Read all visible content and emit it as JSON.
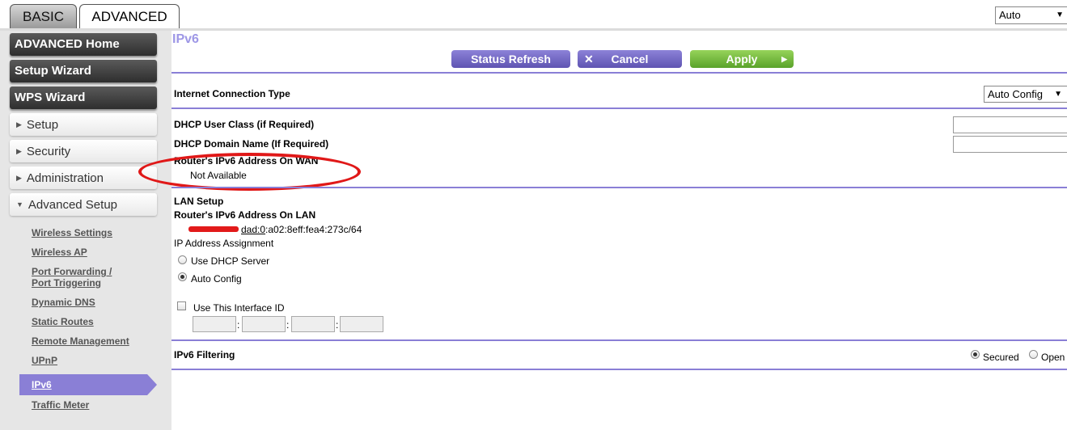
{
  "tabs": {
    "basic": "BASIC",
    "advanced": "ADVANCED"
  },
  "language_select": {
    "value": "Auto"
  },
  "sidebar": {
    "main_items": [
      "ADVANCED Home",
      "Setup Wizard",
      "WPS Wizard"
    ],
    "sections": [
      "Setup",
      "Security",
      "Administration",
      "Advanced Setup"
    ],
    "sub_items": [
      "Wireless Settings",
      "Wireless AP",
      "Port Forwarding /",
      "Port Triggering",
      "Dynamic DNS",
      "Static Routes",
      "Remote Management",
      "UPnP",
      "IPv6",
      "Traffic Meter"
    ]
  },
  "page": {
    "title": "IPv6"
  },
  "buttons": {
    "status_refresh": "Status Refresh",
    "cancel": "Cancel",
    "apply": "Apply"
  },
  "internet": {
    "connection_type_label": "Internet Connection Type",
    "connection_type_value": "Auto Config",
    "dhcp_user_class_label": "DHCP User Class (if Required)",
    "dhcp_user_class_value": "",
    "dhcp_domain_label": "DHCP Domain Name  (If Required)",
    "dhcp_domain_value": "",
    "wan_address_label": "Router's IPv6 Address On WAN",
    "wan_address_value": "Not Available"
  },
  "lan": {
    "heading": "LAN Setup",
    "lan_address_label": "Router's IPv6 Address On LAN",
    "lan_address_visible": "dad:0",
    "lan_address_suffix": ":a02:8eff:fea4:273c/64",
    "ip_assignment_label": "IP Address Assignment",
    "option_dhcp": "Use DHCP Server",
    "option_auto": "Auto Config",
    "interface_id_label": "Use This Interface ID"
  },
  "filtering": {
    "label": "IPv6 Filtering",
    "option_secured": "Secured",
    "option_open": "Open",
    "selected": "Secured"
  },
  "colors": {
    "accent": "#8a7fd6",
    "title": "#9e97e6",
    "apply": "#6fb838",
    "annotation": "#e01818"
  }
}
